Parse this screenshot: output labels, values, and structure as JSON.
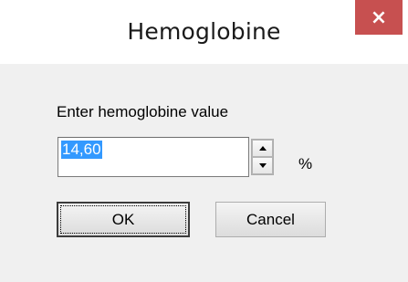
{
  "window": {
    "title": "Hemoglobine",
    "close_glyph": "×",
    "close_color": "#c75050"
  },
  "form": {
    "prompt": "Enter hemoglobine value",
    "value": "14,60",
    "unit": "%",
    "selection_color": "#3399ff"
  },
  "buttons": {
    "ok_label": "OK",
    "cancel_label": "Cancel"
  }
}
